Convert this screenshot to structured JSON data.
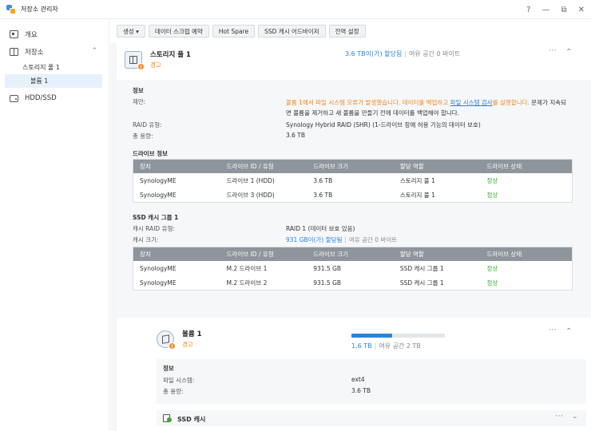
{
  "window": {
    "title": "저장소 관리자",
    "ctrl_help": "?",
    "ctrl_min": "—",
    "ctrl_max": "⧉",
    "ctrl_close": "✕"
  },
  "sidebar": {
    "overview": "개요",
    "storage": "저장소",
    "pool": "스토리지 풀 1",
    "volume": "볼륨 1",
    "hdd": "HDD/SSD"
  },
  "toolbar": {
    "create": "생성 ▾",
    "scrub": "데이터 스크럽 예약",
    "hotspare": "Hot Spare",
    "ssd_advisor": "SSD 캐시 어드바이저",
    "global": "전역 설정"
  },
  "pool": {
    "name": "스토리지 풀 1",
    "status": "경고",
    "allocated": "3.6 TB이(가) 할당됨",
    "free": "여유 공간 0 바이트",
    "info_title": "정보",
    "suggest_label": "제안:",
    "suggest_part1": "볼륨 1에서 파일 시스템 오류가 발생했습니다. 데이터를 백업하고 ",
    "suggest_link": "파일 시스템 검사",
    "suggest_part2": "를 실행합니다.",
    "suggest_part3": " 문제가 지속되",
    "suggest_line2": "면 볼륨을 제거하고 새 볼륨을 만들기 전에 데이터를 백업해야 합니다.",
    "raid_label": "RAID 유형:",
    "raid_value": "Synology Hybrid RAID (SHR) (1-드라이브 장애 허용 기능의 데이터 보호)",
    "capacity_label": "총 용량:",
    "capacity_value": "3.6 TB"
  },
  "drives": {
    "title": "드라이브 정보",
    "headers": [
      "장치",
      "드라이브 ID / 유형",
      "드라이브 크기",
      "할당 역할",
      "드라이브 상태"
    ],
    "rows": [
      [
        "SynologyME",
        "드라이브 1 (HDD)",
        "3.6 TB",
        "스토리지 풀 1",
        "정상"
      ],
      [
        "SynologyME",
        "드라이브 3 (HDD)",
        "3.6 TB",
        "스토리지 풀 1",
        "정상"
      ]
    ]
  },
  "ssd_group": {
    "title": "SSD 캐시 그룹 1",
    "raid_label": "캐시 RAID 유형:",
    "raid_value": "RAID 1 (데이터 보호 있음)",
    "size_label": "캐시 크기:",
    "size_alloc": "931 GB이(가) 할당됨",
    "size_free": "여유 공간 0 바이트",
    "headers": [
      "장치",
      "드라이브 ID / 유형",
      "드라이브 크기",
      "할당 역할",
      "드라이브 상태"
    ],
    "rows": [
      [
        "SynologyME",
        "M.2 드라이브 1",
        "931.5 GB",
        "SSD 캐시 그룹 1",
        "정상"
      ],
      [
        "SynologyME",
        "M.2 드라이브 2",
        "931.5 GB",
        "SSD 캐시 그룹 1",
        "정상"
      ]
    ]
  },
  "volume": {
    "name": "볼륨 1",
    "status": "경고",
    "used": "1.6 TB",
    "free": "여유 공간 2 TB",
    "usage_fraction": 0.44,
    "info_title": "정보",
    "fs_label": "파일 시스템:",
    "fs_value": "ext4",
    "capacity_label": "총 용량:",
    "capacity_value": "3.6 TB",
    "ssd_cache": "SSD 캐시"
  },
  "colors": {
    "accent": "#2b84d8",
    "warning": "#f08a24",
    "ok": "#3fa535",
    "table_header": "#8f959c"
  }
}
